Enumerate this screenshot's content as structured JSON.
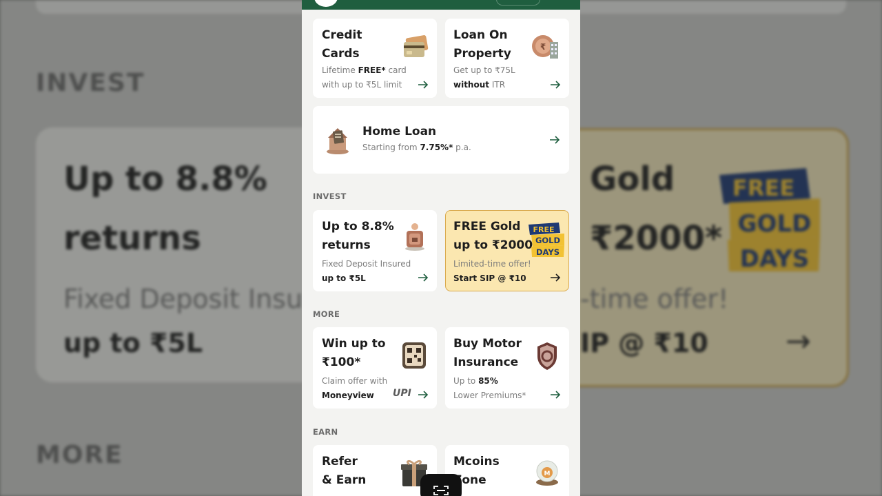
{
  "background": {
    "invest_heading": "INVEST",
    "more_heading": "MORE",
    "left_title_1": "Up to 8.8%",
    "left_title_2": "returns",
    "left_sub": "Fixed Deposit Insur",
    "left_strong": "up to ₹5L",
    "right_title_1": "Gold",
    "right_title_2": "₹2000*",
    "right_sub": "-time offer!",
    "right_strong": "IP @ ₹10",
    "badge": [
      "FREE",
      "GOLD",
      "DAYS"
    ]
  },
  "cards": {
    "credit": {
      "title_1": "Credit",
      "title_2": "Cards",
      "sub_pre": "Lifetime ",
      "sub_bold": "FREE*",
      "sub_post": " card",
      "sub_line2": "with up to ₹5L limit"
    },
    "lop": {
      "title_1": "Loan On",
      "title_2": "Property",
      "sub_line1": "Get up to ₹75L",
      "sub_bold": "without",
      "sub_post": " ITR"
    },
    "home": {
      "title": "Home  Loan",
      "sub_pre": "Starting from  ",
      "sub_bold": "7.75%*",
      "sub_post": " p.a."
    },
    "fd": {
      "title_1": "Up to 8.8%",
      "title_2": "returns",
      "sub_line1": "Fixed Deposit Insured",
      "sub_bold": "up to ₹5L"
    },
    "gold": {
      "title_1": "FREE Gold",
      "title_2": "up to ₹2000*",
      "sub_line1": "Limited-time offer!",
      "sub_bold": "Start SIP @ ₹10",
      "badge": [
        "FREE",
        "GOLD",
        "DAYS"
      ]
    },
    "win": {
      "title_1": "Win up to",
      "title_2": "₹100*",
      "sub_line1": "Claim offer with",
      "sub_bold": "Moneyview",
      "upi": "UPI"
    },
    "motor": {
      "title_1": "Buy Motor",
      "title_2": "Insurance",
      "sub_pre": "Up to ",
      "sub_bold": "85%",
      "sub_line2": "Lower Premiums*"
    },
    "refer": {
      "title_1": "Refer",
      "title_2": "& Earn"
    },
    "mcoins": {
      "title_1": "Mcoins",
      "title_2": "Zone"
    }
  },
  "sections": {
    "invest": "INVEST",
    "more": "MORE",
    "earn": "EARN"
  },
  "colors": {
    "brand_green": "#1f5e3f",
    "gold_bg": "#fbe7b0",
    "gold_border": "#d9a94c",
    "badge_navy": "#1f3a73",
    "badge_yellow": "#f2c233"
  },
  "icons": [
    "credit-card-icon",
    "coin-building-icon",
    "house-document-icon",
    "piggy-bank-icon",
    "qr-code-icon",
    "shield-car-icon",
    "gift-box-icon",
    "coin-globe-icon",
    "arrow-right-icon"
  ]
}
